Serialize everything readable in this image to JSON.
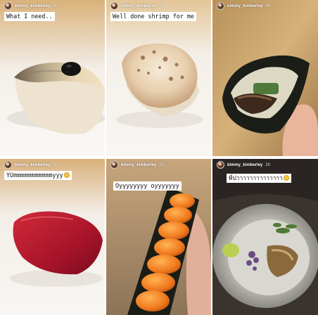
{
  "stories": [
    {
      "username": "kimmy_kimberley",
      "time": "3h",
      "caption": "What I need..",
      "subject": "sushi-nigiri-mackerel-caviar"
    },
    {
      "username": "kimmy_kimberley",
      "time": "3h",
      "caption": "Well done shrimp for me",
      "subject": "sushi-nigiri-seared-shrimp"
    },
    {
      "username": "kimmy_kimberley",
      "time": "3h",
      "caption": "",
      "subject": "temaki-hand-roll-eel"
    },
    {
      "username": "kimmy_kimberley",
      "time": "2h",
      "caption": "YUmmmmmmmmmmmyyy",
      "caption_emoji": "yum-emoji",
      "subject": "sushi-nigiri-tuna"
    },
    {
      "username": "kimmy_kimberley",
      "time": "2h",
      "caption": "Oyyyyyyyy oyyyyyyy",
      "subject": "uni-sea-urchin-roll"
    },
    {
      "username": "kimmy_kimberley",
      "time": "2h",
      "caption": "พี่ปาาาาาาาาาาาาาา",
      "caption_emoji": "smile-emoji",
      "subject": "abalone-shell-dish"
    }
  ],
  "colors": {
    "caption_bg": "#ffffff",
    "caption_text": "#111111",
    "header_text": "#ffffff"
  }
}
